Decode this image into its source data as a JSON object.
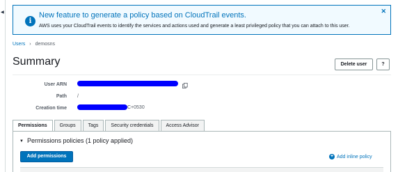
{
  "banner": {
    "title": "New feature to generate a policy based on CloudTrail events.",
    "description": "AWS uses your CloudTrail events to identify the services and actions used and generate a least privileged policy that you can attach to this user.",
    "close_icon": "close-icon",
    "info_icon": "info-icon"
  },
  "breadcrumb": {
    "parent": "Users",
    "current": "demosns"
  },
  "header": {
    "title": "Summary",
    "delete_label": "Delete user",
    "help_label": "?"
  },
  "details": {
    "arn_label": "User ARN",
    "path_label": "Path",
    "path_value": "/",
    "created_label": "Creation time",
    "created_suffix": "C+0530"
  },
  "tabs": [
    "Permissions",
    "Groups",
    "Tags",
    "Security credentials",
    "Access Advisor"
  ],
  "permissions": {
    "header": "Permissions policies (1 policy applied)",
    "add_label": "Add permissions",
    "add_inline_label": "Add inline policy"
  },
  "colors": {
    "accent": "#0073bb",
    "redaction": "#0000ff"
  }
}
